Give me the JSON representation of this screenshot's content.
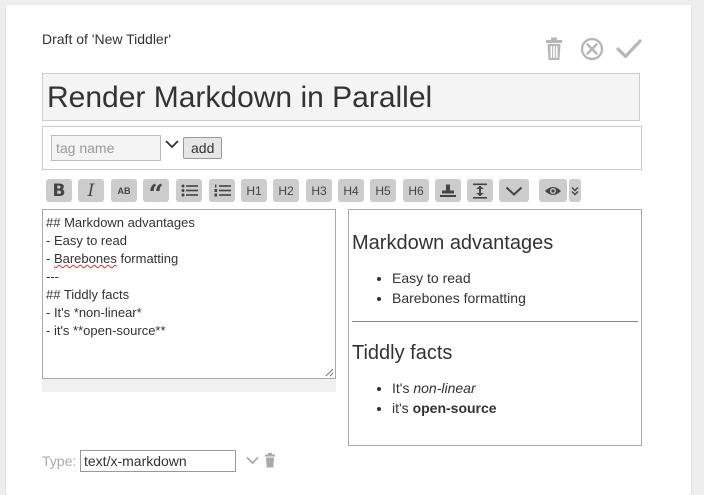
{
  "draft_label": "Draft of 'New Tiddler'",
  "controls": {
    "delete_icon": "trash-icon",
    "cancel_icon": "cancel-circle-icon",
    "save_icon": "checkmark-icon",
    "icon_color": "#b7b7b7"
  },
  "title": {
    "value": "Render Markdown in Parallel"
  },
  "tags": {
    "placeholder": "tag name",
    "add_label": "add"
  },
  "toolbar": {
    "bold": "B",
    "italic": "I",
    "smallcaps": "AB",
    "quote": "“",
    "h1": "H1",
    "h2": "H2",
    "h3": "H3",
    "h4": "H4",
    "h5": "H5",
    "h6": "H6",
    "button_color": "#cccccc"
  },
  "editor": {
    "lines": [
      "## Markdown advantages",
      "- Easy to read",
      "- ",
      "Barebones",
      " formatting",
      "---",
      "## Tiddly facts",
      "- It's *non-linear*",
      "- it's **open-source**"
    ]
  },
  "preview": {
    "heading1": "Markdown advantages",
    "list1": [
      "Easy to read",
      "Barebones formatting"
    ],
    "heading2": "Tiddly facts",
    "item3_prefix": "It's ",
    "item3_em": "non-linear",
    "item4_prefix": "it's ",
    "item4_strong": "open-source"
  },
  "type_field": {
    "label": "Type:",
    "value": "text/x-markdown"
  }
}
